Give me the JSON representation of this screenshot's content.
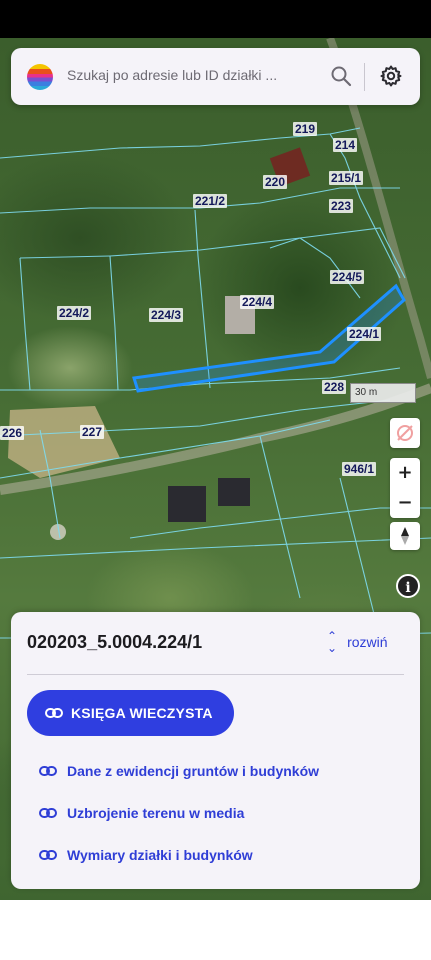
{
  "search": {
    "placeholder": "Szukaj po adresie lub ID działki ...",
    "logo_icon": "multicolor-stripes-logo",
    "search_icon": "search-icon",
    "settings_icon": "gear-icon"
  },
  "map": {
    "parcel_labels": [
      {
        "text": "219"
      },
      {
        "text": "214"
      },
      {
        "text": "220"
      },
      {
        "text": "215/1"
      },
      {
        "text": "221/2"
      },
      {
        "text": "223"
      },
      {
        "text": "224/5"
      },
      {
        "text": "224/2"
      },
      {
        "text": "224/3"
      },
      {
        "text": "224/4"
      },
      {
        "text": "224/1"
      },
      {
        "text": "228"
      },
      {
        "text": "226"
      },
      {
        "text": "227"
      },
      {
        "text": "946/1"
      }
    ],
    "scale_label": "30 m",
    "selected_color": "#1e90ff",
    "boundary_color": "#7fdcf0"
  },
  "controls": {
    "zoom_in": "+",
    "zoom_out": "−",
    "compass_icon": "compass-icon",
    "location_icon": "location-off-icon",
    "info": "i"
  },
  "panel": {
    "plot_id": "020203_5.0004.224/1",
    "expand_label": "rozwiń",
    "primary_button": "KSIĘGA WIECZYSTA",
    "links": [
      {
        "label": "Dane z ewidencji gruntów i budynków"
      },
      {
        "label": "Uzbrojenie terenu w media"
      },
      {
        "label": "Wymiary działki i budynków"
      }
    ],
    "accent_color": "#2f3ee0"
  }
}
